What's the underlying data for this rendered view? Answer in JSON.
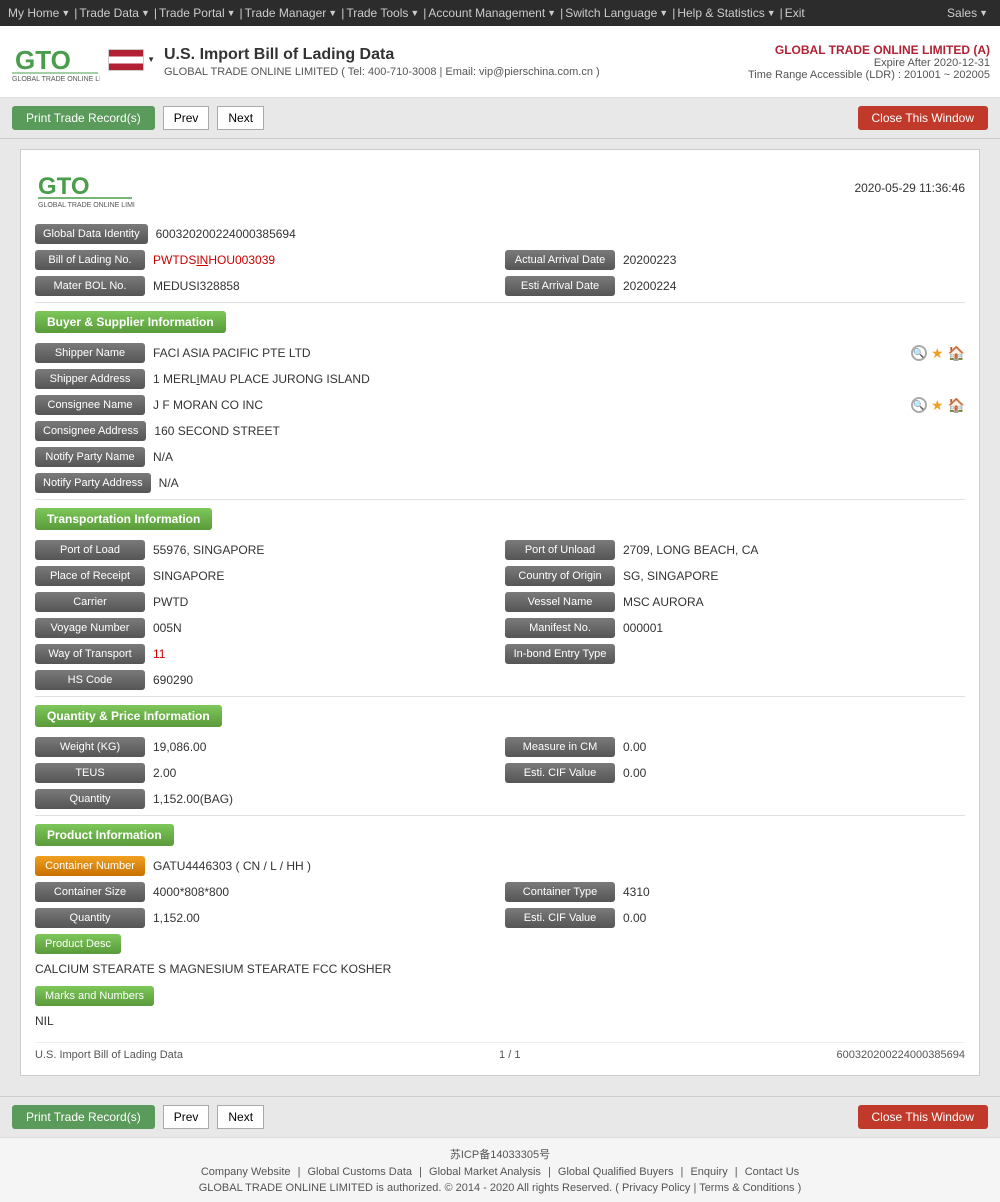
{
  "topnav": {
    "items": [
      "My Home",
      "Trade Data",
      "Trade Portal",
      "Trade Manager",
      "Trade Tools",
      "Account Management",
      "Switch Language",
      "Help & Statistics",
      "Exit"
    ],
    "sales": "Sales"
  },
  "header": {
    "title": "U.S. Import Bill of Lading Data",
    "subtitle": "GLOBAL TRADE ONLINE LIMITED ( Tel: 400-710-3008 | Email: vip@pierschina.com.cn )",
    "company": "GLOBAL TRADE ONLINE LIMITED (A)",
    "expire": "Expire After 2020-12-31",
    "ldr": "Time Range Accessible (LDR) : 201001 ~ 202005"
  },
  "toolbar": {
    "print_label": "Print Trade Record(s)",
    "prev_label": "Prev",
    "next_label": "Next",
    "close_label": "Close This Window"
  },
  "card": {
    "logo_text": "GTO",
    "logo_sub": "GLOBAL TRADE ONLINE LIMITED",
    "date": "2020-05-29 11:36:46",
    "global_data_identity_label": "Global Data Identity",
    "global_data_identity": "600320200224000385694",
    "bol_no_label": "Bill of Lading No.",
    "bol_no": "PWTDSINHOU003039",
    "actual_arrival_date_label": "Actual Arrival Date",
    "actual_arrival_date": "20200223",
    "mater_bol_label": "Mater BOL No.",
    "mater_bol": "MEDUSI328858",
    "esti_arrival_label": "Esti Arrival Date",
    "esti_arrival": "20200224"
  },
  "buyer_supplier": {
    "title": "Buyer & Supplier Information",
    "shipper_name_label": "Shipper Name",
    "shipper_name": "FACI ASIA PACIFIC PTE LTD",
    "shipper_address_label": "Shipper Address",
    "shipper_address": "1 MERLIMAU PLACE JURONG ISLAND",
    "consignee_name_label": "Consignee Name",
    "consignee_name": "J F MORAN CO INC",
    "consignee_address_label": "Consignee Address",
    "consignee_address": "160 SECOND STREET",
    "notify_party_name_label": "Notify Party Name",
    "notify_party_name": "N/A",
    "notify_party_address_label": "Notify Party Address",
    "notify_party_address": "N/A"
  },
  "transportation": {
    "title": "Transportation Information",
    "port_of_load_label": "Port of Load",
    "port_of_load": "55976, SINGAPORE",
    "port_of_unload_label": "Port of Unload",
    "port_of_unload": "2709, LONG BEACH, CA",
    "place_of_receipt_label": "Place of Receipt",
    "place_of_receipt": "SINGAPORE",
    "country_of_origin_label": "Country of Origin",
    "country_of_origin": "SG, SINGAPORE",
    "carrier_label": "Carrier",
    "carrier": "PWTD",
    "vessel_name_label": "Vessel Name",
    "vessel_name": "MSC AURORA",
    "voyage_number_label": "Voyage Number",
    "voyage_number": "005N",
    "manifest_no_label": "Manifest No.",
    "manifest_no": "000001",
    "way_of_transport_label": "Way of Transport",
    "way_of_transport": "11",
    "in_bond_entry_label": "In-bond Entry Type",
    "in_bond_entry": "",
    "hs_code_label": "HS Code",
    "hs_code": "690290"
  },
  "quantity_price": {
    "title": "Quantity & Price Information",
    "weight_label": "Weight (KG)",
    "weight": "19,086.00",
    "measure_cm_label": "Measure in CM",
    "measure_cm": "0.00",
    "teus_label": "TEUS",
    "teus": "2.00",
    "esti_cif_label": "Esti. CIF Value",
    "esti_cif": "0.00",
    "quantity_label": "Quantity",
    "quantity": "1,152.00(BAG)"
  },
  "product": {
    "title": "Product Information",
    "container_num_label": "Container Number",
    "container_num": "GATU4446303 ( CN / L / HH )",
    "container_size_label": "Container Size",
    "container_size": "4000*808*800",
    "container_type_label": "Container Type",
    "container_type": "4310",
    "quantity_label": "Quantity",
    "quantity": "1,152.00",
    "esti_cif_label": "Esti. CIF Value",
    "esti_cif": "0.00",
    "product_desc_label": "Product Desc",
    "product_desc": "CALCIUM STEARATE S MAGNESIUM STEARATE FCC KOSHER",
    "marks_label": "Marks and Numbers",
    "marks_value": "NIL"
  },
  "record_footer": {
    "left": "U.S. Import Bill of Lading Data",
    "center": "1 / 1",
    "right": "600320200224000385694"
  },
  "bottom_toolbar": {
    "print_label": "Print Trade Record(s)",
    "prev_label": "Prev",
    "next_label": "Next",
    "close_label": "Close This Window"
  },
  "site_footer": {
    "icp": "苏ICP备14033305号",
    "links": [
      "Company Website",
      "Global Customs Data",
      "Global Market Analysis",
      "Global Qualified Buyers",
      "Enquiry",
      "Contact Us"
    ],
    "copyright": "GLOBAL TRADE ONLINE LIMITED is authorized. © 2014 - 2020 All rights Reserved.",
    "privacy": "Privacy Policy",
    "terms": "Terms & Conditions"
  }
}
